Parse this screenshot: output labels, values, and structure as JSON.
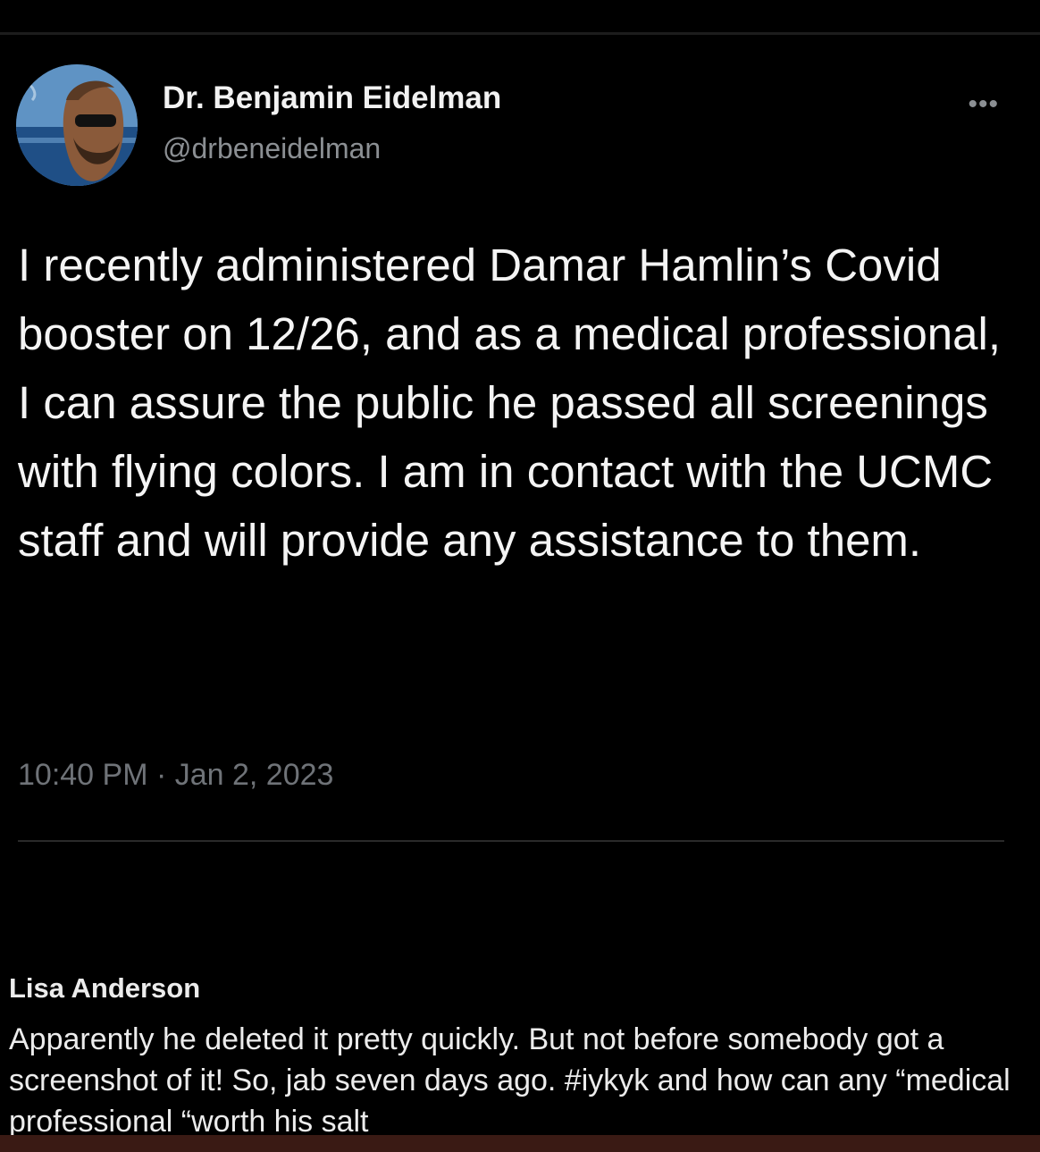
{
  "tweet": {
    "author_name": "Dr. Benjamin Eidelman",
    "author_handle": "@drbeneidelman",
    "more_icon": "more-options-icon",
    "text": "I recently administered Damar Hamlin’s Covid booster on 12/26, and as a medical professional, I can assure the public he passed all screenings with flying colors. I am in contact with the UCMC staff and will provide any assistance to them.",
    "timestamp": "10:40 PM · Jan 2, 2023"
  },
  "comment": {
    "author": "Lisa Anderson",
    "text": "Apparently he deleted it pretty quickly. But not before somebody got a screenshot of it! So, jab seven days ago. #iykyk and how can any “medical professional “worth his salt"
  },
  "colors": {
    "background": "#000000",
    "text_primary": "#f4f4f4",
    "text_secondary": "#8b8f93"
  }
}
